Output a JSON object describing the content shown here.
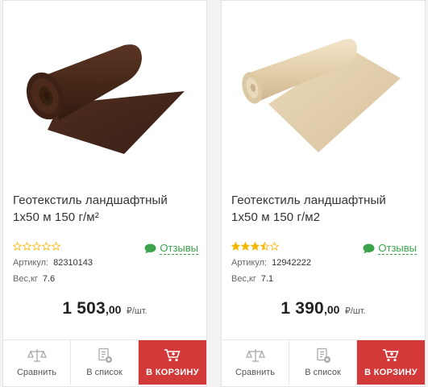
{
  "products": [
    {
      "title_line1": "Геотекстиль ландшафтный",
      "title_line2": "1х50 м 150 г/м²",
      "image": "brown-geotextile-roll",
      "rating": 0,
      "reviews_label": "Отзывы",
      "article_label": "Артикул:",
      "article_value": "82310143",
      "weight_label": "Вес,кг",
      "weight_value": "7.6",
      "price_int": "1 503",
      "price_cents": ",00",
      "price_unit": "₽/шт.",
      "compare_label": "Сравнить",
      "list_label": "В список",
      "cart_label": "В КОРЗИНУ"
    },
    {
      "title_line1": "Геотекстиль ландшафтный",
      "title_line2": "1х50 м 150 г/м2",
      "image": "beige-geotextile-roll",
      "rating": 3.5,
      "reviews_label": "Отзывы",
      "article_label": "Артикул:",
      "article_value": "12942222",
      "weight_label": "Вес,кг",
      "weight_value": "7.1",
      "price_int": "1 390",
      "price_cents": ",00",
      "price_unit": "₽/шт.",
      "compare_label": "Сравнить",
      "list_label": "В список",
      "cart_label": "В КОРЗИНУ"
    }
  ],
  "colors": {
    "star": "#f5b700",
    "star_empty": "#f5b700",
    "reviews": "#3aa34c",
    "cart_bg": "#d4393a",
    "brown_roll": "#4a2a1c",
    "beige_roll": "#e6d2b0"
  }
}
